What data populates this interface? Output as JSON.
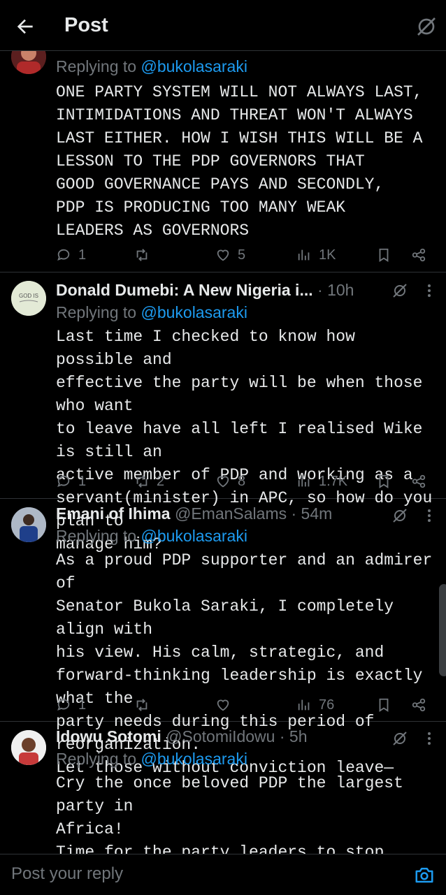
{
  "header": {
    "title": "Post"
  },
  "posts": [
    {
      "name": "",
      "handle_time": "",
      "replying_prefix": "Replying to ",
      "replying_to": "@bukolasaraki",
      "text": "ONE PARTY SYSTEM WILL NOT ALWAYS LAST,\nINTIMIDATIONS AND THREAT WON'T ALWAYS\nLAST EITHER. HOW I WISH THIS WILL BE A\nLESSON TO THE PDP GOVERNORS THAT\nGOOD GOVERNANCE PAYS AND SECONDLY,\nPDP IS PRODUCING TOO MANY WEAK\nLEADERS AS GOVERNORS",
      "stats": {
        "replies": "1",
        "reposts": "",
        "likes": "5",
        "views": "1K"
      }
    },
    {
      "name": "Donald Dumebi: A New Nigeria i...",
      "handle_time": " · 10h",
      "avatar_text": "GOD IS",
      "replying_prefix": "Replying to ",
      "replying_to": "@bukolasaraki",
      "text": "Last time I checked to know how possible and\neffective the party will be when those who want\nto leave have all left I realised Wike is still an\nactive member of PDP and working as a\nservant(minister) in APC, so how do you plan to\nmanage him?",
      "stats": {
        "replies": "1",
        "reposts": "2",
        "likes": "8",
        "views": "1.7K"
      }
    },
    {
      "name": "Emani of Ihima",
      "handle_time": " @EmanSalams · 54m",
      "replying_prefix": "Replying to ",
      "replying_to": "@bukolasaraki",
      "text": "As a proud PDP supporter and an admirer of\nSenator Bukola Saraki, I completely align with\nhis view. His calm, strategic, and\nforward-thinking leadership is exactly what the\nparty needs during this period of reorganization.\nLet those without conviction leave—",
      "stats": {
        "replies": "1",
        "reposts": "",
        "likes": "",
        "views": "76"
      }
    },
    {
      "name": "Idowu Sotomi",
      "handle_time": " @SotomiIdowu · 5h",
      "replying_prefix": "Replying to ",
      "replying_to": "@bukolasaraki",
      "text": "Cry the once beloved PDP the largest party in\nAfrica!\nTime for the party leaders to stop hiding behind\none fingers and stopped shouting themselves"
    }
  ],
  "reply_bar": {
    "placeholder": "Post your reply"
  },
  "colors": {
    "background": "#000000",
    "accent": "#1d9bf0",
    "muted": "#71767b",
    "text": "#e7e9ea"
  }
}
